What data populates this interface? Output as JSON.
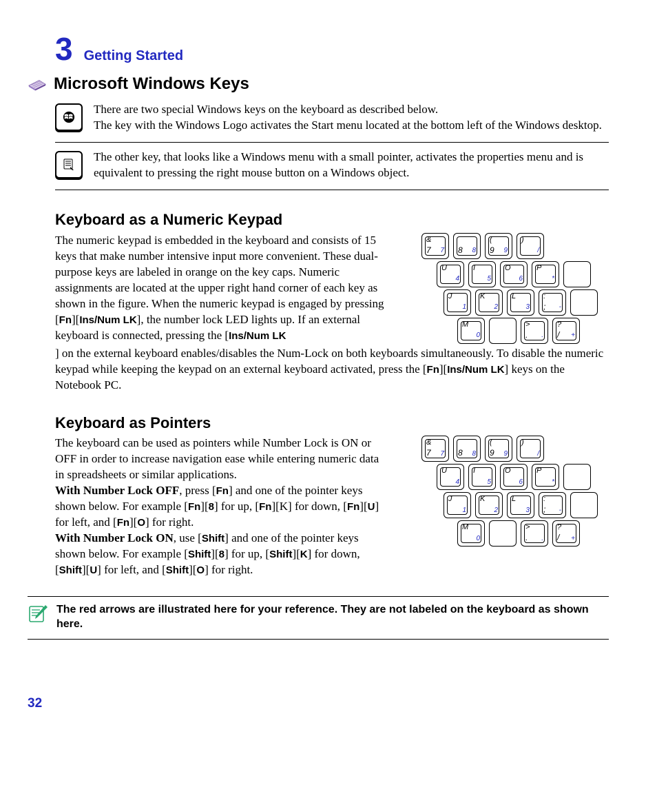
{
  "chapter": {
    "number": "3",
    "title": "Getting Started"
  },
  "section": {
    "title": "Microsoft Windows Keys"
  },
  "info1": {
    "line1": "There are two special Windows keys on the keyboard as described below.",
    "line2": "The key with the Windows Logo activates the Start menu located at the bottom left of the Windows desktop."
  },
  "info2": {
    "text": "The other key, that looks like a Windows menu with a small pointer, activates the properties menu and is equivalent to pressing the right mouse button on a Windows object."
  },
  "numeric": {
    "title": "Keyboard as a Numeric Keypad",
    "p1a": "The numeric keypad is embedded in the keyboard and consists of 15 keys that make number intensive input more convenient. These dual-purpose keys are labeled in orange on the key caps. Numeric assignments are located at the upper right hand corner of each key as shown in the figure. When the numeric keypad is engaged by pressing [",
    "p1b": "], the number lock LED lights up. If an external keyboard is connected, pressing the [",
    "p1c": "] on the external keyboard enables/disables the Num-Lock on both keyboards simultaneously. To disable the numeric keypad while keeping the keypad on an external keyboard activated, press the  [",
    "p1d": "] keys on the Notebook PC.",
    "k_fn": "Fn",
    "k_ins": "Ins/Num LK"
  },
  "pointers": {
    "title": "Keyboard as Pointers",
    "p1": "The keyboard can be used as pointers while Number Lock is ON or OFF in order to increase navigation ease while entering numeric data in spreadsheets or similar applications.",
    "p2_lead": "With Number Lock OFF",
    "p2a": ", press [",
    "p2b": "] and one of the pointer keys shown below. For example [",
    "p2c": "] for up, [",
    "p2d": "][K] for down, [",
    "p2e": "] for left, and [",
    "p2f": "] for right.",
    "p3_lead": "With Number Lock ON",
    "p3a": ", use [",
    "p3b": "] and one of the pointer keys shown below. For example [",
    "p3c": "] for up, [",
    "p3d": "] for down, [",
    "p3e": "] for left, and [",
    "p3f": "] for right.",
    "k_fn": "Fn",
    "k_8": "8",
    "k_U": "U",
    "k_O": "O",
    "k_K": "K",
    "k_shift": "Shift"
  },
  "note": {
    "text": "The red arrows are illustrated here for your reference. They are not labeled on the keyboard as shown here."
  },
  "page_number": "32",
  "keypad": {
    "rows": [
      [
        {
          "top": "&",
          "main": "7",
          "num": "7",
          "active": true
        },
        {
          "top": "",
          "main": "8",
          "num": "8",
          "active": true
        },
        {
          "top": "(",
          "main": "9",
          "num": "9",
          "active": true
        },
        {
          "top": ")",
          "main": "",
          "num": "/",
          "active": true
        }
      ],
      [
        {
          "top": "U",
          "main": "",
          "num": "4",
          "active": true
        },
        {
          "top": "I",
          "main": "",
          "num": "5",
          "active": true
        },
        {
          "top": "O",
          "main": "",
          "num": "6",
          "active": true
        },
        {
          "top": "P",
          "main": "",
          "num": "*",
          "active": true
        },
        {
          "top": "",
          "main": "",
          "num": "",
          "active": false
        }
      ],
      [
        {
          "top": "J",
          "main": "",
          "num": "1",
          "active": true
        },
        {
          "top": "K",
          "main": "",
          "num": "2",
          "active": true
        },
        {
          "top": "L",
          "main": "",
          "num": "3",
          "active": true
        },
        {
          "top": ":",
          "main": ";",
          "num": "-",
          "active": true
        },
        {
          "top": "",
          "main": "",
          "num": "",
          "active": false
        }
      ],
      [
        {
          "top": "M",
          "main": "",
          "num": "0",
          "active": true
        },
        {
          "top": "",
          "main": "",
          "num": "",
          "active": false
        },
        {
          "top": ">",
          "main": ".",
          "num": ".",
          "active": true
        },
        {
          "top": "?",
          "main": "/",
          "num": "+",
          "active": true
        }
      ]
    ]
  }
}
